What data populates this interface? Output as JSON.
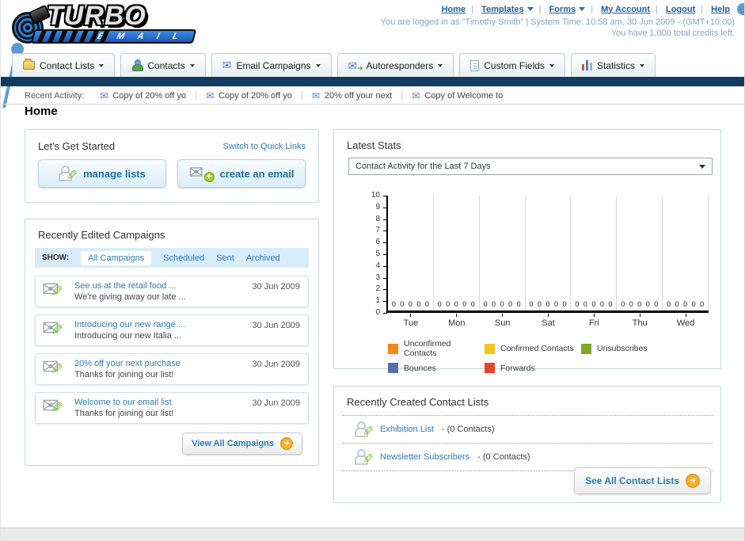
{
  "colors": {
    "navy_bar": "#123C5F",
    "link_blue": "#2D7CB5",
    "accent_orange": "#F5A81C",
    "annotation_blue": "#5B9BD5"
  },
  "logo": {
    "title": "TURBO",
    "subtitle": "E M A I L"
  },
  "header": {
    "nav_links": [
      "Home",
      "Templates",
      "Forms",
      "My Account",
      "Logout",
      "Help"
    ],
    "login_line1": "You are logged in as \"Timothy Smith\" | System Time: 10:58 am, 30 Jun 2009 - (GMT+10:00)",
    "login_line2": "You have 1,000 total credits left."
  },
  "nav_tabs": [
    {
      "label": "Contact Lists"
    },
    {
      "label": "Contacts"
    },
    {
      "label": "Email Campaigns"
    },
    {
      "label": "Autoresponders"
    },
    {
      "label": "Custom Fields"
    },
    {
      "label": "Statistics"
    }
  ],
  "recent_activity": {
    "label": "Recent Activity:",
    "items": [
      "Copy of 20% off yo",
      "Copy of 20% off yo",
      "20% off your next",
      "Copy of Welcome to"
    ]
  },
  "page_title": "Home",
  "get_started": {
    "title": "Let's Get Started",
    "switch_link": "Switch to Quick Links",
    "manage_lists_label": "manage lists",
    "create_email_label": "create an email"
  },
  "campaigns": {
    "title": "Recently Edited Campaigns",
    "show_label": "SHOW:",
    "filters": [
      "All Campaigns",
      "Scheduled",
      "Sent",
      "Archived"
    ],
    "active_filter": "All Campaigns",
    "items": [
      {
        "title": "See us at the retail food ...",
        "subtitle": "We're giving away our late ...",
        "date": "30 Jun 2009"
      },
      {
        "title": "Introducing our new range ...",
        "subtitle": "Introducing our new Italia ...",
        "date": "30 Jun 2009"
      },
      {
        "title": "20% off your next purchase",
        "subtitle": "Thanks for joining our list!",
        "date": "30 Jun 2009"
      },
      {
        "title": "Welcome to our email list",
        "subtitle": "Thanks for joining our list!",
        "date": "30 Jun 2009"
      }
    ],
    "view_all_label": "View All Campaigns"
  },
  "stats": {
    "title": "Latest Stats",
    "dropdown_value": "Contact Activity for the Last 7 Days"
  },
  "chart_data": {
    "type": "bar",
    "title": "Contact Activity for the Last 7 Days",
    "categories": [
      "Tue",
      "Mon",
      "Sun",
      "Sat",
      "Fri",
      "Thu",
      "Wed"
    ],
    "series": [
      {
        "name": "Unconfirmed Contacts",
        "color": "#F2891D",
        "values": [
          0,
          0,
          0,
          0,
          0,
          0,
          0
        ]
      },
      {
        "name": "Confirmed Contacts",
        "color": "#F5C51E",
        "values": [
          0,
          0,
          0,
          0,
          0,
          0,
          0
        ]
      },
      {
        "name": "Unsubscribes",
        "color": "#7FA823",
        "values": [
          0,
          0,
          0,
          0,
          0,
          0,
          0
        ]
      },
      {
        "name": "Bounces",
        "color": "#5571A7",
        "values": [
          0,
          0,
          0,
          0,
          0,
          0,
          0
        ]
      },
      {
        "name": "Forwards",
        "color": "#E84426",
        "values": [
          0,
          0,
          0,
          0,
          0,
          0,
          0
        ]
      }
    ],
    "ylim": [
      0,
      10
    ],
    "ytick_step": 1,
    "grid": "vertical-only",
    "legend_position": "bottom",
    "value_labels": "shown-above-axis"
  },
  "contact_lists": {
    "title": "Recently Created Contact Lists",
    "items": [
      {
        "name": "Exhibition List",
        "detail": "- (0 Contacts)"
      },
      {
        "name": "Newsletter Subscribers",
        "detail": "- (0 Contacts)"
      }
    ],
    "see_all_label": "See All Contact Lists"
  }
}
